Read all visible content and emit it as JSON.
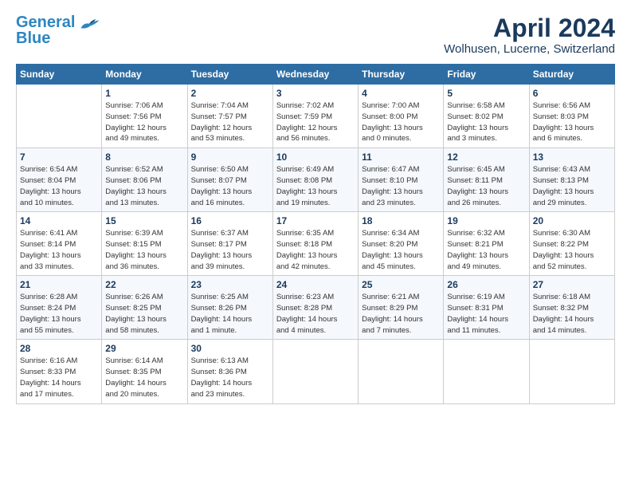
{
  "logo": {
    "line1": "General",
    "line2": "Blue"
  },
  "title": "April 2024",
  "subtitle": "Wolhusen, Lucerne, Switzerland",
  "days_header": [
    "Sunday",
    "Monday",
    "Tuesday",
    "Wednesday",
    "Thursday",
    "Friday",
    "Saturday"
  ],
  "weeks": [
    [
      {
        "day": "",
        "content": ""
      },
      {
        "day": "1",
        "content": "Sunrise: 7:06 AM\nSunset: 7:56 PM\nDaylight: 12 hours\nand 49 minutes."
      },
      {
        "day": "2",
        "content": "Sunrise: 7:04 AM\nSunset: 7:57 PM\nDaylight: 12 hours\nand 53 minutes."
      },
      {
        "day": "3",
        "content": "Sunrise: 7:02 AM\nSunset: 7:59 PM\nDaylight: 12 hours\nand 56 minutes."
      },
      {
        "day": "4",
        "content": "Sunrise: 7:00 AM\nSunset: 8:00 PM\nDaylight: 13 hours\nand 0 minutes."
      },
      {
        "day": "5",
        "content": "Sunrise: 6:58 AM\nSunset: 8:02 PM\nDaylight: 13 hours\nand 3 minutes."
      },
      {
        "day": "6",
        "content": "Sunrise: 6:56 AM\nSunset: 8:03 PM\nDaylight: 13 hours\nand 6 minutes."
      }
    ],
    [
      {
        "day": "7",
        "content": "Sunrise: 6:54 AM\nSunset: 8:04 PM\nDaylight: 13 hours\nand 10 minutes."
      },
      {
        "day": "8",
        "content": "Sunrise: 6:52 AM\nSunset: 8:06 PM\nDaylight: 13 hours\nand 13 minutes."
      },
      {
        "day": "9",
        "content": "Sunrise: 6:50 AM\nSunset: 8:07 PM\nDaylight: 13 hours\nand 16 minutes."
      },
      {
        "day": "10",
        "content": "Sunrise: 6:49 AM\nSunset: 8:08 PM\nDaylight: 13 hours\nand 19 minutes."
      },
      {
        "day": "11",
        "content": "Sunrise: 6:47 AM\nSunset: 8:10 PM\nDaylight: 13 hours\nand 23 minutes."
      },
      {
        "day": "12",
        "content": "Sunrise: 6:45 AM\nSunset: 8:11 PM\nDaylight: 13 hours\nand 26 minutes."
      },
      {
        "day": "13",
        "content": "Sunrise: 6:43 AM\nSunset: 8:13 PM\nDaylight: 13 hours\nand 29 minutes."
      }
    ],
    [
      {
        "day": "14",
        "content": "Sunrise: 6:41 AM\nSunset: 8:14 PM\nDaylight: 13 hours\nand 33 minutes."
      },
      {
        "day": "15",
        "content": "Sunrise: 6:39 AM\nSunset: 8:15 PM\nDaylight: 13 hours\nand 36 minutes."
      },
      {
        "day": "16",
        "content": "Sunrise: 6:37 AM\nSunset: 8:17 PM\nDaylight: 13 hours\nand 39 minutes."
      },
      {
        "day": "17",
        "content": "Sunrise: 6:35 AM\nSunset: 8:18 PM\nDaylight: 13 hours\nand 42 minutes."
      },
      {
        "day": "18",
        "content": "Sunrise: 6:34 AM\nSunset: 8:20 PM\nDaylight: 13 hours\nand 45 minutes."
      },
      {
        "day": "19",
        "content": "Sunrise: 6:32 AM\nSunset: 8:21 PM\nDaylight: 13 hours\nand 49 minutes."
      },
      {
        "day": "20",
        "content": "Sunrise: 6:30 AM\nSunset: 8:22 PM\nDaylight: 13 hours\nand 52 minutes."
      }
    ],
    [
      {
        "day": "21",
        "content": "Sunrise: 6:28 AM\nSunset: 8:24 PM\nDaylight: 13 hours\nand 55 minutes."
      },
      {
        "day": "22",
        "content": "Sunrise: 6:26 AM\nSunset: 8:25 PM\nDaylight: 13 hours\nand 58 minutes."
      },
      {
        "day": "23",
        "content": "Sunrise: 6:25 AM\nSunset: 8:26 PM\nDaylight: 14 hours\nand 1 minute."
      },
      {
        "day": "24",
        "content": "Sunrise: 6:23 AM\nSunset: 8:28 PM\nDaylight: 14 hours\nand 4 minutes."
      },
      {
        "day": "25",
        "content": "Sunrise: 6:21 AM\nSunset: 8:29 PM\nDaylight: 14 hours\nand 7 minutes."
      },
      {
        "day": "26",
        "content": "Sunrise: 6:19 AM\nSunset: 8:31 PM\nDaylight: 14 hours\nand 11 minutes."
      },
      {
        "day": "27",
        "content": "Sunrise: 6:18 AM\nSunset: 8:32 PM\nDaylight: 14 hours\nand 14 minutes."
      }
    ],
    [
      {
        "day": "28",
        "content": "Sunrise: 6:16 AM\nSunset: 8:33 PM\nDaylight: 14 hours\nand 17 minutes."
      },
      {
        "day": "29",
        "content": "Sunrise: 6:14 AM\nSunset: 8:35 PM\nDaylight: 14 hours\nand 20 minutes."
      },
      {
        "day": "30",
        "content": "Sunrise: 6:13 AM\nSunset: 8:36 PM\nDaylight: 14 hours\nand 23 minutes."
      },
      {
        "day": "",
        "content": ""
      },
      {
        "day": "",
        "content": ""
      },
      {
        "day": "",
        "content": ""
      },
      {
        "day": "",
        "content": ""
      }
    ]
  ]
}
